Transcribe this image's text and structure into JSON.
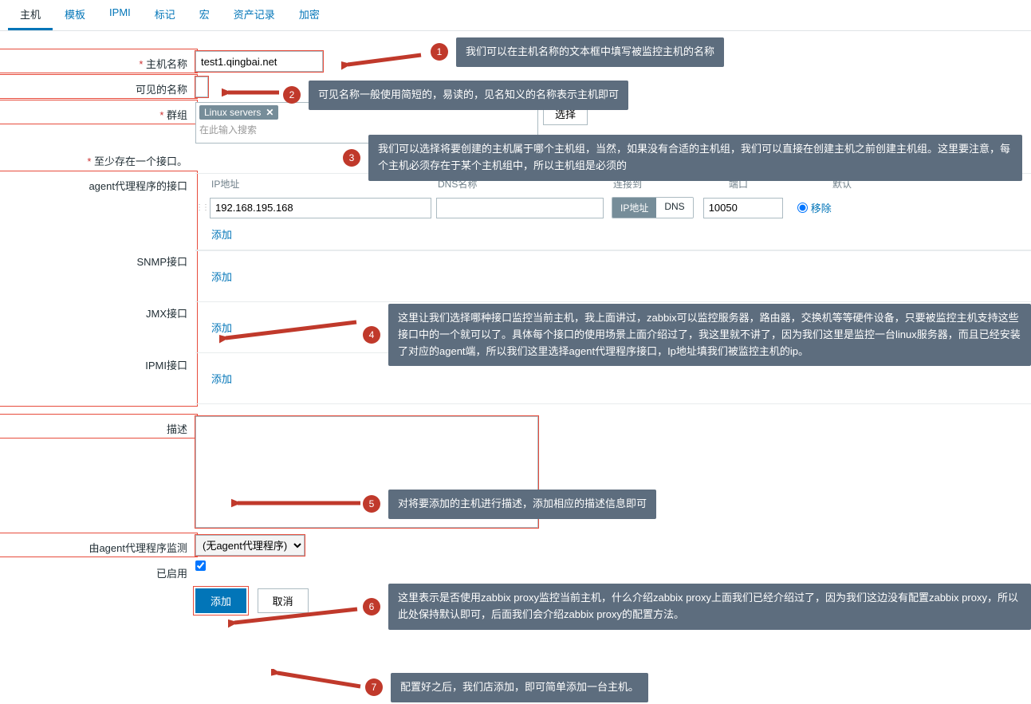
{
  "tabs": [
    "主机",
    "模板",
    "IPMI",
    "标记",
    "宏",
    "资产记录",
    "加密"
  ],
  "form": {
    "hostname_label": "主机名称",
    "hostname_value": "test1.qingbai.net",
    "visiblename_label": "可见的名称",
    "visiblename_value": "",
    "groups_label": "群组",
    "group_chip": "Linux servers",
    "group_placeholder": "在此输入搜索",
    "select_btn": "选择",
    "at_least_one": "至少存在一个接口。",
    "iface_agent": "agent代理程序的接口",
    "iface_snmp": "SNMP接口",
    "iface_jmx": "JMX接口",
    "iface_ipmi": "IPMI接口",
    "head_ip": "IP地址",
    "head_dns": "DNS名称",
    "head_conn": "连接到",
    "head_port": "端口",
    "head_default": "默认",
    "ip_value": "192.168.195.168",
    "dns_value": "",
    "conn_ip": "IP地址",
    "conn_dns": "DNS",
    "port_value": "10050",
    "remove": "移除",
    "add_link": "添加",
    "desc_label": "描述",
    "proxy_label": "由agent代理程序监测",
    "proxy_value": "(无agent代理程序)",
    "enabled_label": "已启用",
    "btn_add": "添加",
    "btn_cancel": "取消"
  },
  "annotations": {
    "a1": "我们可以在主机名称的文本框中填写被监控主机的名称",
    "a2": "可见名称一般使用简短的，易读的，见名知义的名称表示主机即可",
    "a3": "我们可以选择将要创建的主机属于哪个主机组，当然，如果没有合适的主机组，我们可以直接在创建主机之前创建主机组。这里要注意，每个主机必须存在于某个主机组中，所以主机组是必须的",
    "a4": "这里让我们选择哪种接口监控当前主机，我上面讲过，zabbix可以监控服务器，路由器，交换机等等硬件设备，只要被监控主机支持这些接口中的一个就可以了。具体每个接口的使用场景上面介绍过了，我这里就不讲了，因为我们这里是监控一台linux服务器，而且已经安装了对应的agent端，所以我们这里选择agent代理程序接口，Ip地址填我们被监控主机的ip。",
    "a5": "对将要添加的主机进行描述，添加相应的描述信息即可",
    "a6": "这里表示是否使用zabbix proxy监控当前主机，什么介绍zabbix proxy上面我们已经介绍过了，因为我们这边没有配置zabbix proxy，所以此处保持默认即可，后面我们会介绍zabbix proxy的配置方法。",
    "a7": "配置好之后，我们店添加，即可简单添加一台主机。"
  }
}
